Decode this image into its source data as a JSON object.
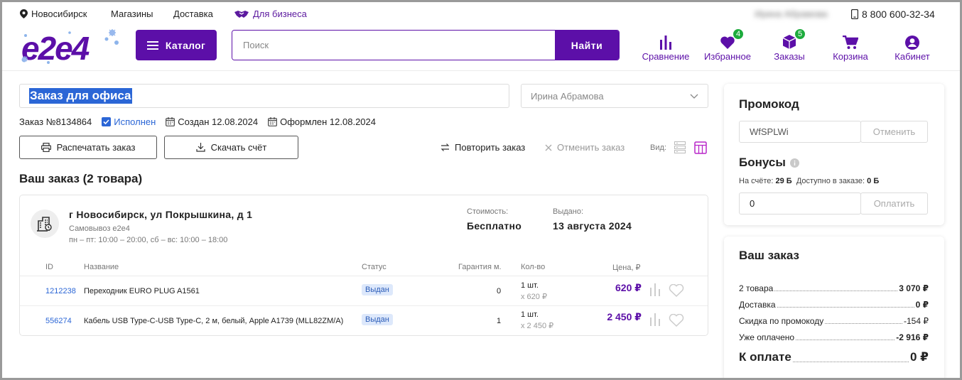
{
  "topbar": {
    "city": "Новосибирск",
    "stores": "Магазины",
    "delivery": "Доставка",
    "business": "Для бизнеса",
    "user_blur": "Ирина Абрамова",
    "phone": "8 800 600-32-34"
  },
  "header": {
    "logo": "e2e4",
    "catalog_label": "Каталог",
    "search_placeholder": "Поиск",
    "search_button": "Найти",
    "nav": [
      {
        "label": "Сравнение",
        "icon": "bar-chart-icon"
      },
      {
        "label": "Избранное",
        "icon": "heart-icon",
        "badge": "4"
      },
      {
        "label": "Заказы",
        "icon": "box-icon",
        "badge": "5"
      },
      {
        "label": "Корзина",
        "icon": "cart-icon"
      },
      {
        "label": "Кабинет",
        "icon": "user-icon"
      }
    ]
  },
  "order": {
    "title": "Заказ для офиса",
    "person": "Ирина Абрамова",
    "number": "Заказ №8134864",
    "status": "Исполнен",
    "created": "Создан 12.08.2024",
    "placed": "Оформлен 12.08.2024",
    "print_label": "Распечатать заказ",
    "download_label": "Скачать счёт",
    "repeat_label": "Повторить заказ",
    "cancel_label": "Отменить заказ",
    "view_label": "Вид:",
    "heading": "Ваш заказ (2 товара)"
  },
  "shipment": {
    "address": "г Новосибирск, ул Покрышкина, д 1",
    "type": "Самовывоз e2e4",
    "hours": "пн – пт: 10:00 – 20:00, сб – вс: 10:00 – 18:00",
    "cost_label": "Стоимость:",
    "cost_value": "Бесплатно",
    "issued_label": "Выдано:",
    "issued_value": "13 августа 2024"
  },
  "table": {
    "headers": [
      "ID",
      "Название",
      "Статус",
      "Гарантия м.",
      "Кол-во",
      "Цена, ₽"
    ],
    "rows": [
      {
        "id": "1212238",
        "name": "Переходник EURO PLUG A1561",
        "status": "Выдан",
        "warranty": "0",
        "qty": "1 шт.",
        "qty_sub": "x 620 ₽",
        "price": "620 ₽"
      },
      {
        "id": "556274",
        "name": "Кабель USB Type-C-USB Type-C, 2 м, белый, Apple A1739 (MLL82ZM/A)",
        "status": "Выдан",
        "warranty": "1",
        "qty": "1 шт.",
        "qty_sub": "x 2 450 ₽",
        "price": "2 450 ₽"
      }
    ]
  },
  "promo": {
    "title": "Промокод",
    "code": "WfSPLWi",
    "cancel": "Отменить",
    "bonus_title": "Бонусы",
    "on_account_label": "На счёте:",
    "on_account_value": "29 Б",
    "available_label": "Доступно в заказе:",
    "available_value": "0 Б",
    "bonus_input": "0",
    "pay": "Оплатить"
  },
  "summary": {
    "title": "Ваш заказ",
    "rows": [
      {
        "label": "2 товара",
        "value": "3 070 ₽"
      },
      {
        "label": "Доставка",
        "value": "0 ₽"
      },
      {
        "label": "Скидка по промокоду",
        "value": "-154 ₽"
      },
      {
        "label": "Уже оплачено",
        "value": "-2 916 ₽"
      }
    ],
    "total_label": "К оплате",
    "total_value": "0 ₽"
  },
  "colors": {
    "brand": "#5c0fa8",
    "accent_blue": "#2b66d6",
    "badge_green": "#1dab3d"
  }
}
